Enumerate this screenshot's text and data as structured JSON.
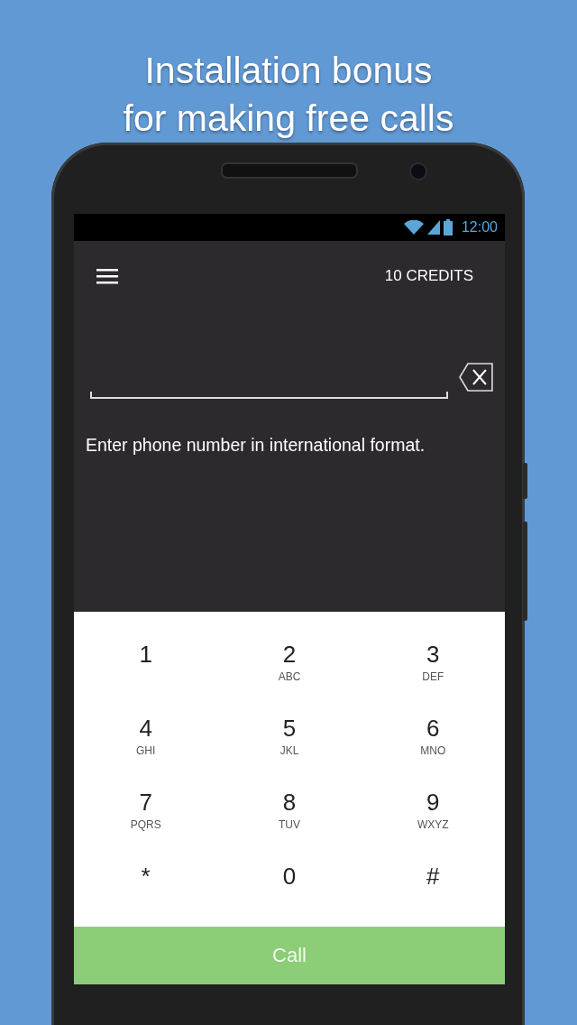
{
  "headline": [
    "Installation bonus",
    "for making free calls"
  ],
  "status_bar": {
    "time": "12:00"
  },
  "app_bar": {
    "credits": "10 CREDITS"
  },
  "hint": "Enter phone number in international format.",
  "keypad": [
    {
      "digit": "1"
    },
    {
      "digit": "2",
      "letters": "ABC"
    },
    {
      "digit": "3",
      "letters": "DEF"
    },
    {
      "digit": "4",
      "letters": "GHI"
    },
    {
      "digit": "5",
      "letters": "JKL"
    },
    {
      "digit": "6",
      "letters": "MNO"
    },
    {
      "digit": "7",
      "letters": "PQRS"
    },
    {
      "digit": "8",
      "letters": "TUV"
    },
    {
      "digit": "9",
      "letters": "WXYZ"
    },
    {
      "digit": "*"
    },
    {
      "digit": "0"
    },
    {
      "digit": "#"
    }
  ],
  "call_button": "Call"
}
